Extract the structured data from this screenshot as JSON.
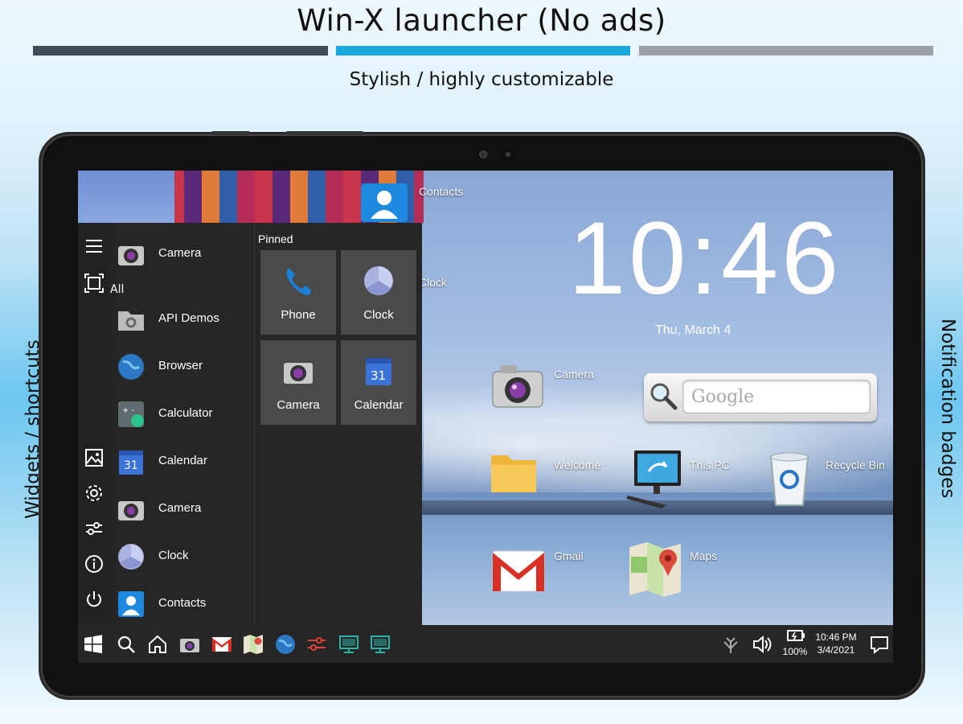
{
  "banner": {
    "title": "Win-X launcher (No ads)",
    "subtitle": "Stylish / highly customizable",
    "left_side_label": "Widgets / shortcuts",
    "right_side_label": "Notification badges",
    "bar_colors": [
      "#414d55",
      "#1aa9df",
      "#9aa0a5"
    ]
  },
  "desktop": {
    "clock_time": "10:46",
    "clock_date": "Thu, March 4",
    "search_placeholder": "Google",
    "icons": [
      {
        "label": "Contacts",
        "icon": "contacts-icon"
      },
      {
        "label": "Clock",
        "icon": "clock-icon"
      },
      {
        "label": "Camera",
        "icon": "camera-icon"
      },
      {
        "label": "Welcome",
        "icon": "folder-icon"
      },
      {
        "label": "This PC",
        "icon": "monitor-icon"
      },
      {
        "label": "Recycle Bin",
        "icon": "recycle-bin-icon"
      },
      {
        "label": "Gmail",
        "icon": "gmail-icon"
      },
      {
        "label": "Maps",
        "icon": "maps-icon"
      }
    ]
  },
  "start_menu": {
    "recent_item": "Camera",
    "all_label": "All",
    "apps": [
      "API Demos",
      "Browser",
      "Calculator",
      "Calendar",
      "Camera",
      "Clock",
      "Contacts"
    ],
    "pinned_label": "Pinned",
    "pinned": [
      "Phone",
      "Clock",
      "Camera",
      "Calendar"
    ],
    "calendar_day": "31",
    "rail_icons": [
      "menu-icon",
      "screenshot-icon",
      "image-icon",
      "gear-icon",
      "sliders-icon",
      "info-icon",
      "power-icon"
    ]
  },
  "taskbar": {
    "icons": [
      "windows-start-icon",
      "search-icon",
      "home-icon",
      "camera-icon",
      "gmail-icon",
      "maps-icon",
      "browser-icon",
      "settings-sliders-icon",
      "monitor-icon",
      "monitor-icon"
    ],
    "battery": "100%",
    "time": "10:46 PM",
    "date": "3/4/2021"
  }
}
